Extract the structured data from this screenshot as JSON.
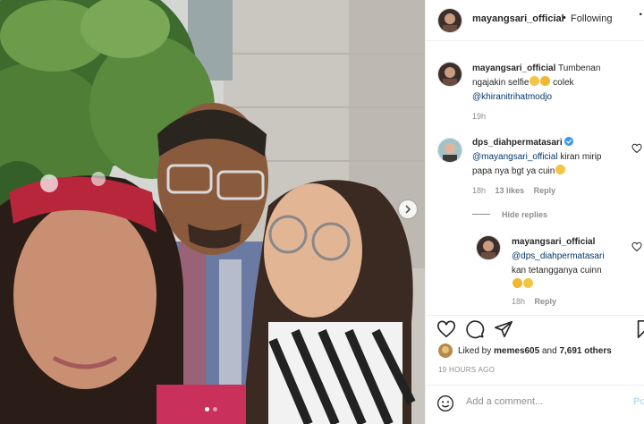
{
  "post": {
    "owner": "mayangsari_official",
    "separator": "•",
    "follow_status": "Following",
    "more": "..."
  },
  "caption": {
    "username": "mayangsari_official",
    "text_line1": "Tumbenan",
    "text_line2": "ngajakin selfie",
    "text_line2b": "colek",
    "mention": "@khiranitrihatmodjo",
    "time": "19h"
  },
  "comments": [
    {
      "username": "dps_diahpermatasari",
      "mention": "@mayangsari_official",
      "text1": "kiran mirip",
      "text2": "papa nya bgt ya cuin",
      "time": "18h",
      "likes": "13 likes",
      "reply": "Reply",
      "verified": true
    },
    {
      "username": "mayangsari_official",
      "mention": "@dps_diahpermatasari",
      "text1": "kan tetangganya cuinn",
      "time": "18h",
      "reply": "Reply"
    }
  ],
  "hide_replies": "Hide replies",
  "likes": {
    "prefix": "Liked by",
    "user": "memes605",
    "middle": "and",
    "others": "7,691 others"
  },
  "timestamp": "19 HOURS AGO",
  "add_comment": {
    "placeholder": "Add a comment...",
    "post": "Po"
  },
  "carousel": {
    "slides": 2,
    "current": 1
  },
  "colors": {
    "link": "#00376b",
    "muted": "#8e8e8e",
    "verified": "#3897f0",
    "post_disabled": "#b2dffc"
  },
  "icons": [
    "heart-icon",
    "comment-icon",
    "share-icon",
    "bookmark-icon",
    "emoji-icon",
    "chevron-right-icon",
    "verified-icon"
  ]
}
